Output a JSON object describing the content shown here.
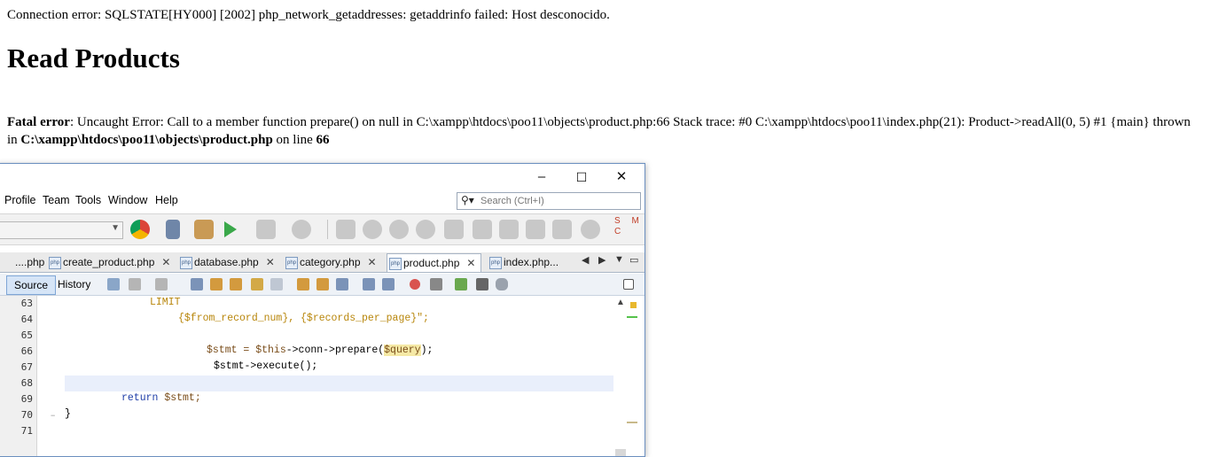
{
  "error_message": "Connection error: SQLSTATE[HY000] [2002] php_network_getaddresses: getaddrinfo failed: Host desconocido.",
  "heading": "Read Products",
  "fatal": {
    "label": "Fatal error",
    "message": ": Uncaught Error: Call to a member function prepare() on null in C:\\xampp\\htdocs\\poo11\\objects\\product.php:66 Stack trace: #0 C:\\xampp\\htdocs\\poo11\\index.php(21): Product->readAll(0, 5) #1 {main} thrown in ",
    "file": "C:\\xampp\\htdocs\\poo11\\objects\\product.php",
    "on_line_text": " on line ",
    "line": "66"
  },
  "window_controls": {
    "minimize": "–",
    "maximize": "☐",
    "close": "✕"
  },
  "menu": [
    "Profile",
    "Team",
    "Tools",
    "Window",
    "Help"
  ],
  "search": {
    "placeholder": "Search (Ctrl+I)"
  },
  "toolbar": {
    "smc_label": "S M C"
  },
  "tabs": [
    {
      "label": "....php",
      "active": false
    },
    {
      "label": "create_product.php",
      "active": false
    },
    {
      "label": "database.php",
      "active": false
    },
    {
      "label": "category.php",
      "active": false
    },
    {
      "label": "product.php",
      "active": true
    },
    {
      "label": "index.php...",
      "active": false
    }
  ],
  "editor_tools": {
    "source": "Source",
    "history": "History"
  },
  "code": {
    "line_numbers": [
      "63",
      "64",
      "65",
      "66",
      "67",
      "68",
      "69",
      "70",
      "71"
    ],
    "limit": "LIMIT",
    "line64": "{$from_record_num}, {$records_per_page}\";",
    "line66_a": "$stmt = ",
    "line66_b": "$this",
    "line66_c": "->conn->prepare(",
    "line66_d": "$query",
    "line66_e": ");",
    "line67": "$stmt->execute();",
    "line69_kw": "return",
    "line69_var": " $stmt;",
    "line70": "}"
  },
  "colors": {
    "accent": "#7fa6d6",
    "current_line": "#e9effb",
    "keyword": "#1f3ea8"
  }
}
